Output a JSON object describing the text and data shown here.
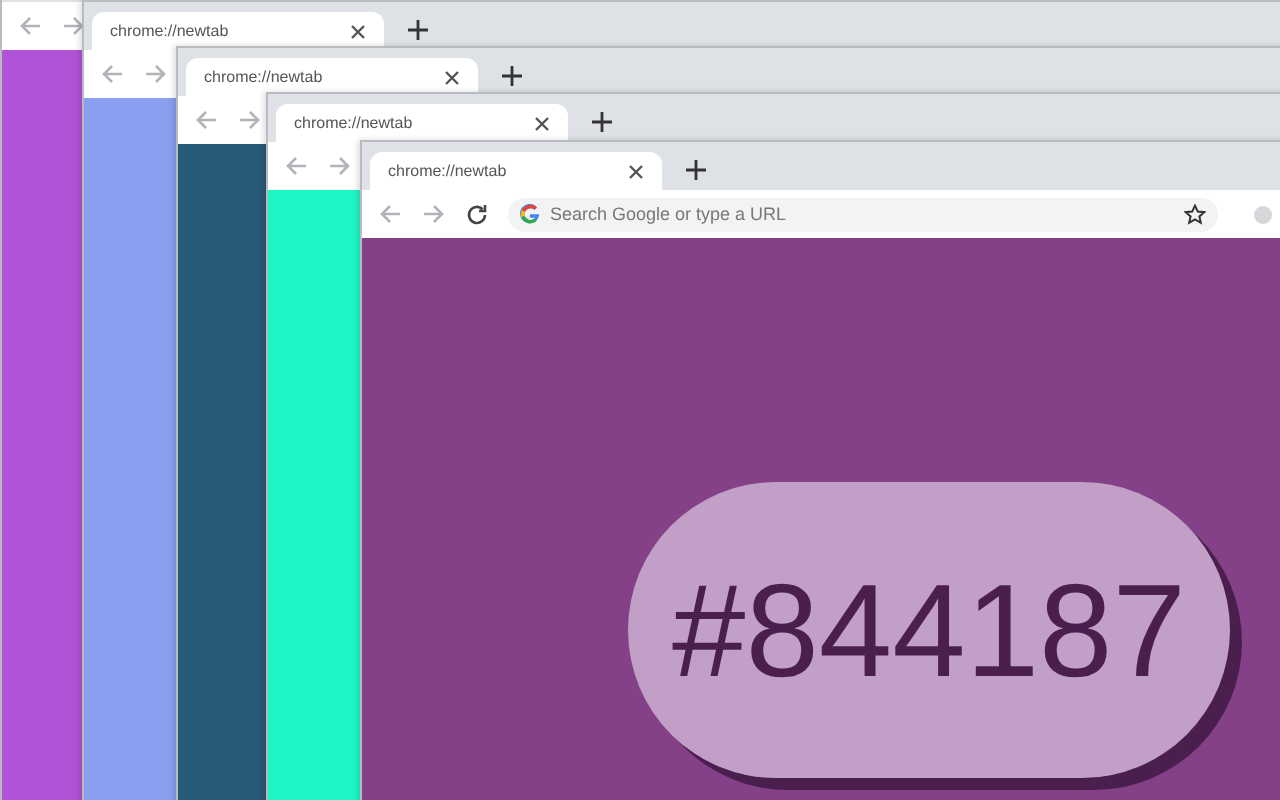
{
  "windows": [
    {
      "color": "#b153d7"
    },
    {
      "tab_title": "chrome://newtab",
      "color": "#8a9ff0"
    },
    {
      "tab_title": "chrome://newtab",
      "color": "#275a78"
    },
    {
      "tab_title": "chrome://newtab",
      "color": "#1ef5c5"
    },
    {
      "tab_title": "chrome://newtab",
      "color": "#844187",
      "omnibox": {
        "placeholder": "Search Google or type a URL"
      },
      "swatch_label": "#844187"
    }
  ]
}
